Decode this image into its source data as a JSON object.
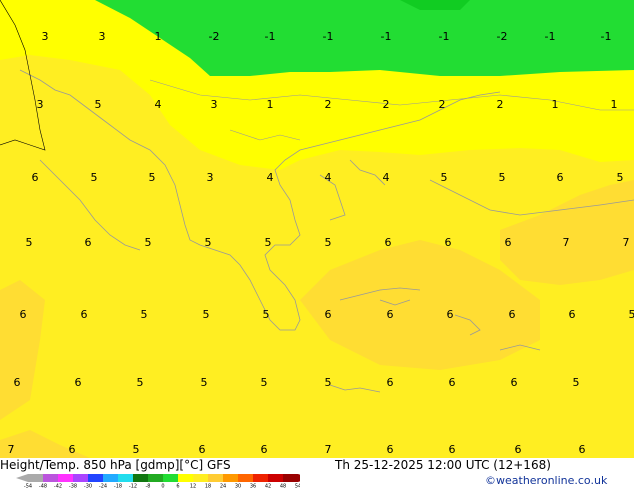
{
  "map": {
    "colors": {
      "green": "#22dd33",
      "green_dark": "#11cc22",
      "yellow_light": "#ffff00",
      "yellow": "#ffee22",
      "yellow_mid": "#ffdd33",
      "yellow_orange": "#ffcc33",
      "coast": "#999999",
      "border": "#000000"
    },
    "contour_labels": [
      {
        "v": "3",
        "r": 0,
        "c": 0
      },
      {
        "v": "3",
        "r": 0,
        "c": 1
      },
      {
        "v": "1",
        "r": 0,
        "c": 2
      },
      {
        "v": "-2",
        "r": 0,
        "c": 3
      },
      {
        "v": "-1",
        "r": 0,
        "c": 4
      },
      {
        "v": "-1",
        "r": 0,
        "c": 5
      },
      {
        "v": "-1",
        "r": 0,
        "c": 6
      },
      {
        "v": "-1",
        "r": 0,
        "c": 7
      },
      {
        "v": "-2",
        "r": 0,
        "c": 8
      },
      {
        "v": "-1",
        "r": 0,
        "c": 9
      },
      {
        "v": "-1",
        "r": 0,
        "c": 10
      },
      {
        "v": "3",
        "r": 1,
        "c": 0
      },
      {
        "v": "5",
        "r": 1,
        "c": 1
      },
      {
        "v": "4",
        "r": 1,
        "c": 2
      },
      {
        "v": "3",
        "r": 1,
        "c": 3
      },
      {
        "v": "1",
        "r": 1,
        "c": 4
      },
      {
        "v": "2",
        "r": 1,
        "c": 5
      },
      {
        "v": "2",
        "r": 1,
        "c": 6
      },
      {
        "v": "2",
        "r": 1,
        "c": 7
      },
      {
        "v": "2",
        "r": 1,
        "c": 8
      },
      {
        "v": "1",
        "r": 1,
        "c": 9
      },
      {
        "v": "1",
        "r": 1,
        "c": 10
      },
      {
        "v": "6",
        "r": 2,
        "c": 0
      },
      {
        "v": "5",
        "r": 2,
        "c": 1
      },
      {
        "v": "5",
        "r": 2,
        "c": 2
      },
      {
        "v": "3",
        "r": 2,
        "c": 3
      },
      {
        "v": "4",
        "r": 2,
        "c": 4
      },
      {
        "v": "4",
        "r": 2,
        "c": 5
      },
      {
        "v": "4",
        "r": 2,
        "c": 6
      },
      {
        "v": "5",
        "r": 2,
        "c": 7
      },
      {
        "v": "5",
        "r": 2,
        "c": 8
      },
      {
        "v": "6",
        "r": 2,
        "c": 9
      },
      {
        "v": "5",
        "r": 2,
        "c": 10
      },
      {
        "v": "5",
        "r": 3,
        "c": 0
      },
      {
        "v": "6",
        "r": 3,
        "c": 1
      },
      {
        "v": "5",
        "r": 3,
        "c": 2
      },
      {
        "v": "5",
        "r": 3,
        "c": 3
      },
      {
        "v": "5",
        "r": 3,
        "c": 4
      },
      {
        "v": "5",
        "r": 3,
        "c": 5
      },
      {
        "v": "6",
        "r": 3,
        "c": 6
      },
      {
        "v": "6",
        "r": 3,
        "c": 7
      },
      {
        "v": "6",
        "r": 3,
        "c": 8
      },
      {
        "v": "7",
        "r": 3,
        "c": 9
      },
      {
        "v": "7",
        "r": 3,
        "c": 10
      },
      {
        "v": "6",
        "r": 4,
        "c": 0
      },
      {
        "v": "6",
        "r": 4,
        "c": 1
      },
      {
        "v": "5",
        "r": 4,
        "c": 2
      },
      {
        "v": "5",
        "r": 4,
        "c": 3
      },
      {
        "v": "5",
        "r": 4,
        "c": 4
      },
      {
        "v": "6",
        "r": 4,
        "c": 5
      },
      {
        "v": "6",
        "r": 4,
        "c": 6
      },
      {
        "v": "6",
        "r": 4,
        "c": 7
      },
      {
        "v": "6",
        "r": 4,
        "c": 8
      },
      {
        "v": "6",
        "r": 4,
        "c": 9
      },
      {
        "v": "5",
        "r": 4,
        "c": 10
      },
      {
        "v": "6",
        "r": 5,
        "c": 0
      },
      {
        "v": "6",
        "r": 5,
        "c": 1
      },
      {
        "v": "5",
        "r": 5,
        "c": 2
      },
      {
        "v": "5",
        "r": 5,
        "c": 3
      },
      {
        "v": "5",
        "r": 5,
        "c": 4
      },
      {
        "v": "5",
        "r": 5,
        "c": 5
      },
      {
        "v": "6",
        "r": 5,
        "c": 6
      },
      {
        "v": "6",
        "r": 5,
        "c": 7
      },
      {
        "v": "6",
        "r": 5,
        "c": 8
      },
      {
        "v": "5",
        "r": 5,
        "c": 9
      },
      {
        "v": "7",
        "r": 6,
        "c": 0
      },
      {
        "v": "6",
        "r": 6,
        "c": 1
      },
      {
        "v": "5",
        "r": 6,
        "c": 2
      },
      {
        "v": "6",
        "r": 6,
        "c": 3
      },
      {
        "v": "6",
        "r": 6,
        "c": 4
      },
      {
        "v": "7",
        "r": 6,
        "c": 5
      },
      {
        "v": "6",
        "r": 6,
        "c": 6
      },
      {
        "v": "6",
        "r": 6,
        "c": 7
      },
      {
        "v": "6",
        "r": 6,
        "c": 8
      },
      {
        "v": "6",
        "r": 6,
        "c": 9
      }
    ]
  },
  "footer": {
    "title": "Height/Temp. 850 hPa [gdmp][°C] GFS",
    "datetime": "Th 25-12-2025 12:00 UTC (12+168)",
    "credit": "©weatheronline.co.uk",
    "colorbar": {
      "labels": [
        "-54",
        "-48",
        "-42",
        "-38",
        "-30",
        "-24",
        "-18",
        "-12",
        "-8",
        "0",
        "6",
        "12",
        "18",
        "24",
        "30",
        "36",
        "42",
        "48",
        "54"
      ],
      "colors": [
        "#aaaaaa",
        "#bb55dd",
        "#ff33ff",
        "#aa44ff",
        "#2244ff",
        "#22aaff",
        "#22ddee",
        "#117711",
        "#22aa22",
        "#22dd33",
        "#ffff00",
        "#ffee22",
        "#ffcc33",
        "#ff9900",
        "#ff6600",
        "#ee2200",
        "#cc0000",
        "#990000"
      ]
    }
  }
}
